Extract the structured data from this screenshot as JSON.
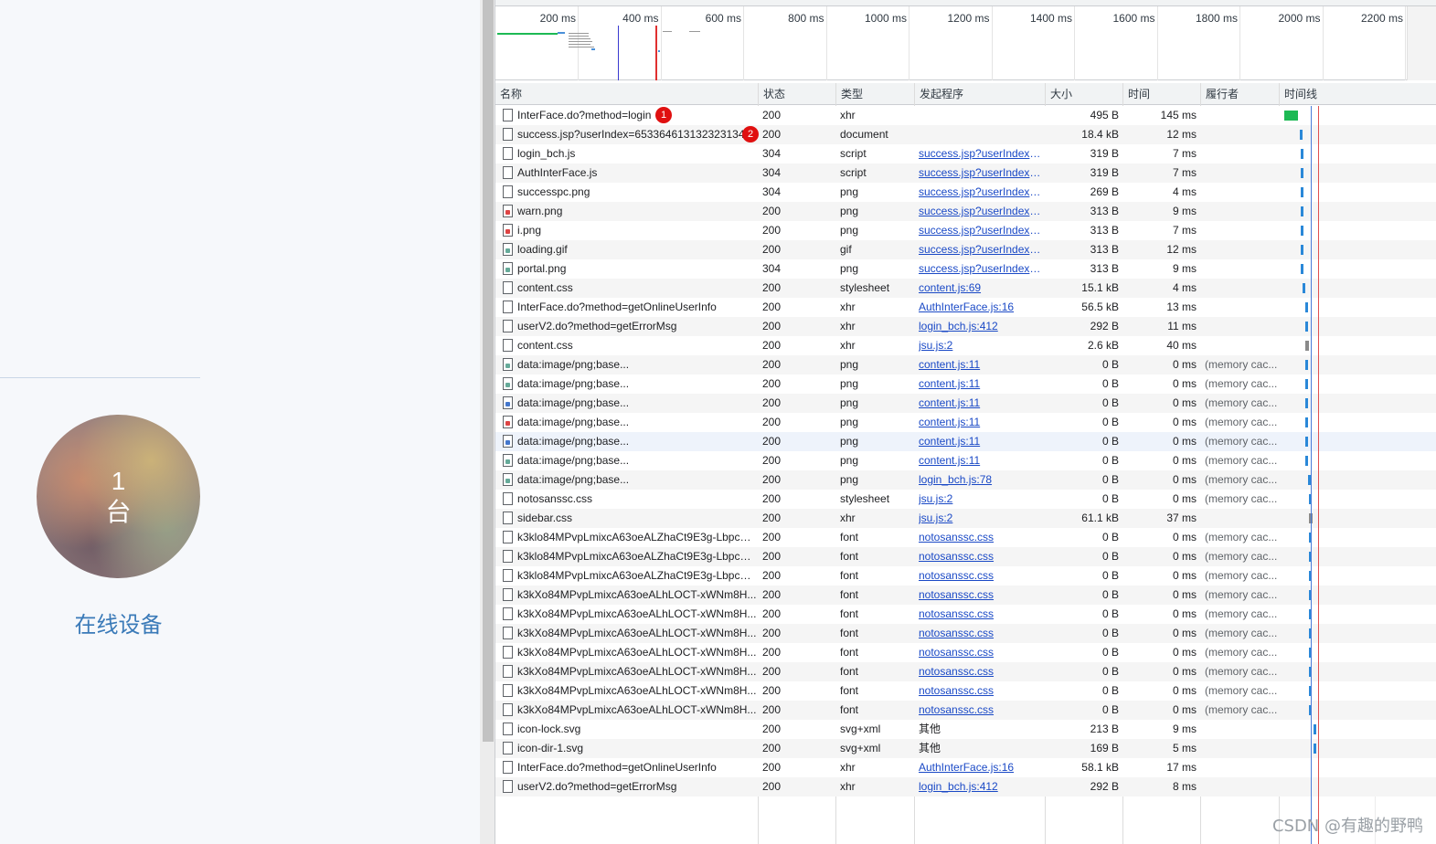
{
  "left_page": {
    "device_count": "1",
    "device_unit": "台",
    "online_label": "在线设备"
  },
  "overview": {
    "ticks": [
      "200 ms",
      "400 ms",
      "600 ms",
      "800 ms",
      "1000 ms",
      "1200 ms",
      "1400 ms",
      "1600 ms",
      "1800 ms",
      "2000 ms",
      "2200 ms"
    ]
  },
  "columns": {
    "name": "名称",
    "status": "状态",
    "type": "类型",
    "initiator": "发起程序",
    "size": "大小",
    "time": "时间",
    "fulfilled_by": "履行者",
    "waterfall": "时间线"
  },
  "rows": [
    {
      "name": "InterFace.do?method=login",
      "status": "200",
      "type": "xhr",
      "initiator": "",
      "size": "495 B",
      "time": "145 ms",
      "fulfilled_by": "",
      "badge": "1",
      "icon": "file"
    },
    {
      "name": "success.jsp?userIndex=65336461313232313435...",
      "status": "200",
      "type": "document",
      "initiator": "",
      "size": "18.4 kB",
      "time": "12 ms",
      "fulfilled_by": "",
      "badge": "2",
      "icon": "file"
    },
    {
      "name": "login_bch.js",
      "status": "304",
      "type": "script",
      "initiator": "success.jsp?userIndex=...",
      "size": "319 B",
      "time": "7 ms",
      "fulfilled_by": "",
      "icon": "file"
    },
    {
      "name": "AuthInterFace.js",
      "status": "304",
      "type": "script",
      "initiator": "success.jsp?userIndex=...",
      "size": "319 B",
      "time": "7 ms",
      "fulfilled_by": "",
      "icon": "file"
    },
    {
      "name": "successpc.png",
      "status": "304",
      "type": "png",
      "initiator": "success.jsp?userIndex=...",
      "size": "269 B",
      "time": "4 ms",
      "fulfilled_by": "",
      "icon": "file"
    },
    {
      "name": "warn.png",
      "status": "200",
      "type": "png",
      "initiator": "success.jsp?userIndex=...",
      "size": "313 B",
      "time": "9 ms",
      "fulfilled_by": "",
      "icon": "img"
    },
    {
      "name": "i.png",
      "status": "200",
      "type": "png",
      "initiator": "success.jsp?userIndex=...",
      "size": "313 B",
      "time": "7 ms",
      "fulfilled_by": "",
      "icon": "img"
    },
    {
      "name": "loading.gif",
      "status": "200",
      "type": "gif",
      "initiator": "success.jsp?userIndex=...",
      "size": "313 B",
      "time": "12 ms",
      "fulfilled_by": "",
      "icon": "img-g"
    },
    {
      "name": "portal.png",
      "status": "304",
      "type": "png",
      "initiator": "success.jsp?userIndex=...",
      "size": "313 B",
      "time": "9 ms",
      "fulfilled_by": "",
      "icon": "img-g"
    },
    {
      "name": "content.css",
      "status": "200",
      "type": "stylesheet",
      "initiator": "content.js:69",
      "size": "15.1 kB",
      "time": "4 ms",
      "fulfilled_by": "",
      "icon": "file"
    },
    {
      "name": "InterFace.do?method=getOnlineUserInfo",
      "status": "200",
      "type": "xhr",
      "initiator": "AuthInterFace.js:16",
      "size": "56.5 kB",
      "time": "13 ms",
      "fulfilled_by": "",
      "icon": "file"
    },
    {
      "name": "userV2.do?method=getErrorMsg",
      "status": "200",
      "type": "xhr",
      "initiator": "login_bch.js:412",
      "size": "292 B",
      "time": "11 ms",
      "fulfilled_by": "",
      "icon": "file"
    },
    {
      "name": "content.css",
      "status": "200",
      "type": "xhr",
      "initiator": "jsu.js:2",
      "size": "2.6 kB",
      "time": "40 ms",
      "fulfilled_by": "",
      "icon": "file"
    },
    {
      "name": "data:image/png;base...",
      "status": "200",
      "type": "png",
      "initiator": "content.js:11",
      "size": "0 B",
      "time": "0 ms",
      "fulfilled_by": "(memory cac...",
      "icon": "img-g"
    },
    {
      "name": "data:image/png;base...",
      "status": "200",
      "type": "png",
      "initiator": "content.js:11",
      "size": "0 B",
      "time": "0 ms",
      "fulfilled_by": "(memory cac...",
      "icon": "img-g"
    },
    {
      "name": "data:image/png;base...",
      "status": "200",
      "type": "png",
      "initiator": "content.js:11",
      "size": "0 B",
      "time": "0 ms",
      "fulfilled_by": "(memory cac...",
      "icon": "img-b"
    },
    {
      "name": "data:image/png;base...",
      "status": "200",
      "type": "png",
      "initiator": "content.js:11",
      "size": "0 B",
      "time": "0 ms",
      "fulfilled_by": "(memory cac...",
      "icon": "img"
    },
    {
      "name": "data:image/png;base...",
      "status": "200",
      "type": "png",
      "initiator": "content.js:11",
      "size": "0 B",
      "time": "0 ms",
      "fulfilled_by": "(memory cac...",
      "icon": "img-b",
      "highlight": true
    },
    {
      "name": "data:image/png;base...",
      "status": "200",
      "type": "png",
      "initiator": "content.js:11",
      "size": "0 B",
      "time": "0 ms",
      "fulfilled_by": "(memory cac...",
      "icon": "img-g"
    },
    {
      "name": "data:image/png;base...",
      "status": "200",
      "type": "png",
      "initiator": "login_bch.js:78",
      "size": "0 B",
      "time": "0 ms",
      "fulfilled_by": "(memory cac...",
      "icon": "img-g"
    },
    {
      "name": "notosanssc.css",
      "status": "200",
      "type": "stylesheet",
      "initiator": "jsu.js:2",
      "size": "0 B",
      "time": "0 ms",
      "fulfilled_by": "(memory cac...",
      "icon": "file"
    },
    {
      "name": "sidebar.css",
      "status": "200",
      "type": "xhr",
      "initiator": "jsu.js:2",
      "size": "61.1 kB",
      "time": "37 ms",
      "fulfilled_by": "",
      "icon": "file"
    },
    {
      "name": "k3klo84MPvpLmixcA63oeALZhaCt9E3g-Lbpcnr...",
      "status": "200",
      "type": "font",
      "initiator": "notosanssc.css",
      "size": "0 B",
      "time": "0 ms",
      "fulfilled_by": "(memory cac...",
      "icon": "file"
    },
    {
      "name": "k3klo84MPvpLmixcA63oeALZhaCt9E3g-Lbpcnr...",
      "status": "200",
      "type": "font",
      "initiator": "notosanssc.css",
      "size": "0 B",
      "time": "0 ms",
      "fulfilled_by": "(memory cac...",
      "icon": "file"
    },
    {
      "name": "k3klo84MPvpLmixcA63oeALZhaCt9E3g-Lbpcnr...",
      "status": "200",
      "type": "font",
      "initiator": "notosanssc.css",
      "size": "0 B",
      "time": "0 ms",
      "fulfilled_by": "(memory cac...",
      "icon": "file"
    },
    {
      "name": "k3kXo84MPvpLmixcA63oeALhLOCT-xWNm8H...",
      "status": "200",
      "type": "font",
      "initiator": "notosanssc.css",
      "size": "0 B",
      "time": "0 ms",
      "fulfilled_by": "(memory cac...",
      "icon": "file"
    },
    {
      "name": "k3kXo84MPvpLmixcA63oeALhLOCT-xWNm8H...",
      "status": "200",
      "type": "font",
      "initiator": "notosanssc.css",
      "size": "0 B",
      "time": "0 ms",
      "fulfilled_by": "(memory cac...",
      "icon": "file"
    },
    {
      "name": "k3kXo84MPvpLmixcA63oeALhLOCT-xWNm8H...",
      "status": "200",
      "type": "font",
      "initiator": "notosanssc.css",
      "size": "0 B",
      "time": "0 ms",
      "fulfilled_by": "(memory cac...",
      "icon": "file"
    },
    {
      "name": "k3kXo84MPvpLmixcA63oeALhLOCT-xWNm8H...",
      "status": "200",
      "type": "font",
      "initiator": "notosanssc.css",
      "size": "0 B",
      "time": "0 ms",
      "fulfilled_by": "(memory cac...",
      "icon": "file"
    },
    {
      "name": "k3kXo84MPvpLmixcA63oeALhLOCT-xWNm8H...",
      "status": "200",
      "type": "font",
      "initiator": "notosanssc.css",
      "size": "0 B",
      "time": "0 ms",
      "fulfilled_by": "(memory cac...",
      "icon": "file"
    },
    {
      "name": "k3kXo84MPvpLmixcA63oeALhLOCT-xWNm8H...",
      "status": "200",
      "type": "font",
      "initiator": "notosanssc.css",
      "size": "0 B",
      "time": "0 ms",
      "fulfilled_by": "(memory cac...",
      "icon": "file"
    },
    {
      "name": "k3kXo84MPvpLmixcA63oeALhLOCT-xWNm8H...",
      "status": "200",
      "type": "font",
      "initiator": "notosanssc.css",
      "size": "0 B",
      "time": "0 ms",
      "fulfilled_by": "(memory cac...",
      "icon": "file"
    },
    {
      "name": "icon-lock.svg",
      "status": "200",
      "type": "svg+xml",
      "initiator": "其他",
      "size": "213 B",
      "time": "9 ms",
      "fulfilled_by": "",
      "icon": "file",
      "initiator_plain": true
    },
    {
      "name": "icon-dir-1.svg",
      "status": "200",
      "type": "svg+xml",
      "initiator": "其他",
      "size": "169 B",
      "time": "5 ms",
      "fulfilled_by": "",
      "icon": "file",
      "initiator_plain": true
    },
    {
      "name": "InterFace.do?method=getOnlineUserInfo",
      "status": "200",
      "type": "xhr",
      "initiator": "AuthInterFace.js:16",
      "size": "58.1 kB",
      "time": "17 ms",
      "fulfilled_by": "",
      "icon": "file"
    },
    {
      "name": "userV2.do?method=getErrorMsg",
      "status": "200",
      "type": "xhr",
      "initiator": "login_bch.js:412",
      "size": "292 B",
      "time": "8 ms",
      "fulfilled_by": "",
      "icon": "file"
    }
  ],
  "waterfall": [
    {
      "start": 0,
      "dur": 145,
      "color": "#1db954"
    },
    {
      "start": 160,
      "dur": 12,
      "color": "#2a88d8"
    },
    {
      "start": 170,
      "dur": 7,
      "color": "#2a88d8"
    },
    {
      "start": 172,
      "dur": 7,
      "color": "#2a88d8"
    },
    {
      "start": 174,
      "dur": 4,
      "color": "#2a88d8"
    },
    {
      "start": 176,
      "dur": 9,
      "color": "#2a88d8"
    },
    {
      "start": 176,
      "dur": 7,
      "color": "#2a88d8"
    },
    {
      "start": 176,
      "dur": 12,
      "color": "#2a88d8"
    },
    {
      "start": 176,
      "dur": 9,
      "color": "#2a88d8"
    },
    {
      "start": 190,
      "dur": 4,
      "color": "#2a88d8"
    },
    {
      "start": 220,
      "dur": 13,
      "color": "#2a88d8"
    },
    {
      "start": 220,
      "dur": 11,
      "color": "#2a88d8"
    },
    {
      "start": 220,
      "dur": 40,
      "color": "#8a8a8a"
    },
    {
      "start": 220,
      "dur": 1,
      "color": "#2a88d8"
    },
    {
      "start": 220,
      "dur": 1,
      "color": "#2a88d8"
    },
    {
      "start": 220,
      "dur": 1,
      "color": "#2a88d8"
    },
    {
      "start": 220,
      "dur": 1,
      "color": "#2a88d8"
    },
    {
      "start": 220,
      "dur": 1,
      "color": "#2a88d8"
    },
    {
      "start": 220,
      "dur": 1,
      "color": "#2a88d8"
    },
    {
      "start": 245,
      "dur": 1,
      "color": "#2a88d8"
    },
    {
      "start": 260,
      "dur": 1,
      "color": "#2a88d8"
    },
    {
      "start": 260,
      "dur": 37,
      "color": "#8a8a8a"
    },
    {
      "start": 260,
      "dur": 1,
      "color": "#2a88d8"
    },
    {
      "start": 260,
      "dur": 1,
      "color": "#2a88d8"
    },
    {
      "start": 260,
      "dur": 1,
      "color": "#2a88d8"
    },
    {
      "start": 260,
      "dur": 1,
      "color": "#2a88d8"
    },
    {
      "start": 260,
      "dur": 1,
      "color": "#2a88d8"
    },
    {
      "start": 260,
      "dur": 1,
      "color": "#2a88d8"
    },
    {
      "start": 260,
      "dur": 1,
      "color": "#2a88d8"
    },
    {
      "start": 260,
      "dur": 1,
      "color": "#2a88d8"
    },
    {
      "start": 260,
      "dur": 1,
      "color": "#2a88d8"
    },
    {
      "start": 260,
      "dur": 1,
      "color": "#2a88d8"
    },
    {
      "start": 300,
      "dur": 9,
      "color": "#2a88d8"
    },
    {
      "start": 300,
      "dur": 5,
      "color": "#2a88d8"
    },
    {
      "start": 0,
      "dur": 0,
      "color": "#2a88d8"
    },
    {
      "start": 0,
      "dur": 0,
      "color": "#2a88d8"
    }
  ],
  "watermark": "CSDN @有趣的野鸭"
}
